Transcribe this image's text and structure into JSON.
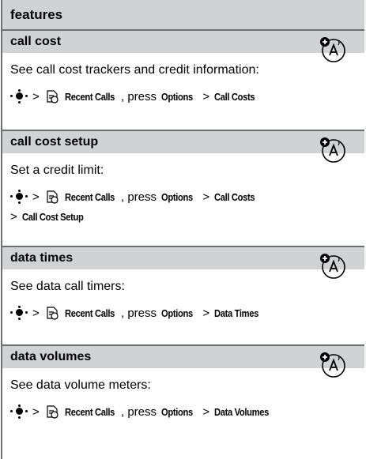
{
  "header": {
    "title": "features"
  },
  "sections": [
    {
      "title": "call cost",
      "desc": "See call cost trackers and credit information:",
      "path": {
        "gt1": ">",
        "recent": "Recent Calls",
        "press": ", press",
        "options": "Options",
        "gt2": ">",
        "item": "Call Costs"
      }
    },
    {
      "title": "call cost setup",
      "desc": "Set a credit limit:",
      "path": {
        "gt1": ">",
        "recent": "Recent Calls",
        "press": ", press",
        "options": "Options",
        "gt2": ">",
        "item": "Call Costs"
      },
      "path2": {
        "gt": ">",
        "item": "Call Cost Setup"
      }
    },
    {
      "title": "data times",
      "desc": "See data call timers:",
      "path": {
        "gt1": ">",
        "recent": "Recent Calls",
        "press": ", press",
        "options": "Options",
        "gt2": ">",
        "item": "Data Times"
      }
    },
    {
      "title": "data volumes",
      "desc": "See data volume meters:",
      "path": {
        "gt1": ">",
        "recent": "Recent Calls",
        "press": ", press",
        "options": "Options",
        "gt2": ">",
        "item": "Data Volumes"
      }
    }
  ],
  "icons": {
    "network_badge": "network-dependent-feature-icon",
    "nav_key": "navigation-key-icon",
    "recent_calls": "recent-calls-icon"
  },
  "colors": {
    "rule": "#6d6e71",
    "band": "#d1d2d3"
  }
}
